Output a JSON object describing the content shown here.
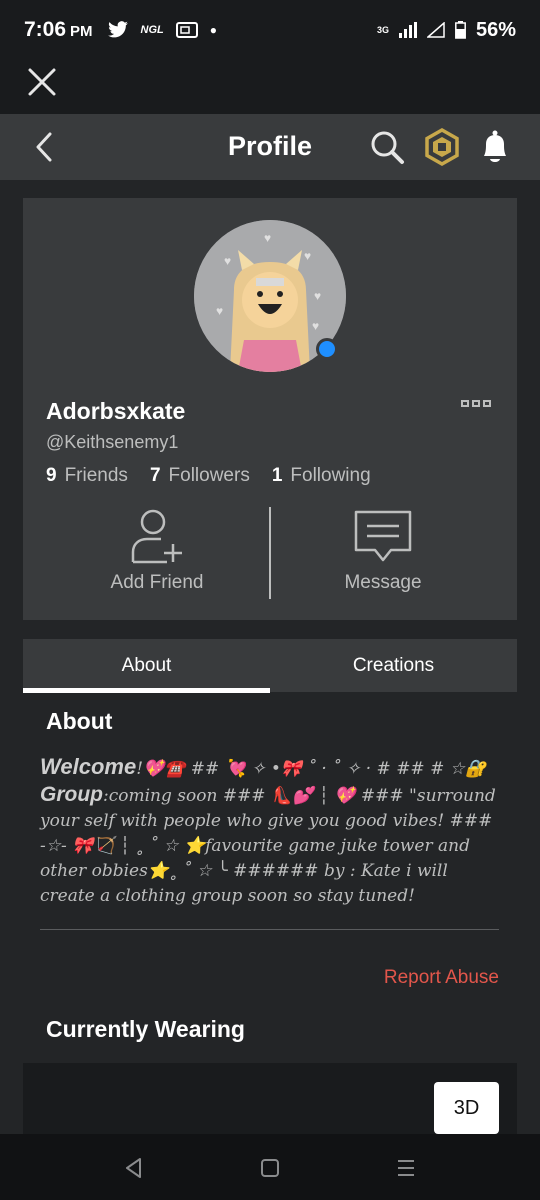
{
  "status": {
    "time": "7:06",
    "ampm": "PM",
    "carrier_label": "NGL",
    "battery": "56%",
    "network": "3G"
  },
  "header": {
    "title": "Profile"
  },
  "profile": {
    "display_name": "Adorbsxkate",
    "username": "@Keithsenemy1",
    "friends_count": "9",
    "friends_label": "Friends",
    "followers_count": "7",
    "followers_label": "Followers",
    "following_count": "1",
    "following_label": "Following"
  },
  "actions": {
    "add_friend": "Add Friend",
    "message": "Message"
  },
  "tabs": [
    {
      "label": "About"
    },
    {
      "label": "Creations"
    }
  ],
  "about": {
    "heading": "About",
    "welcome": "Welcome",
    "emoji_1": "!💖☎️ ## 💘 ✧ •🎀 ˚ · ˚ ✧ · #",
    "line_2": "## # ☆🔐 ",
    "group": "Group",
    "group_rest": ":coming soon ### 👠💕",
    "body": "┆ 💖 ### \"surround your self with people who give you good vibes! ### -☆- 🎀🏹 ┆ ˳ ˚ ☆ ⭐favourite game juke tower and other obbies⭐˳ ˚ ☆ ╰ ###### by : Kate i will create a clothing group soon so stay tuned!",
    "report": "Report Abuse"
  },
  "wearing": {
    "heading": "Currently Wearing",
    "btn_3d": "3D"
  },
  "colors": {
    "background": "#232527",
    "card": "#393b3d",
    "presence": "#1f8fff",
    "report": "#e2564b",
    "robux_gold": "#c8a84b"
  },
  "icons": {
    "close": "close-icon",
    "back": "back-chevron-icon",
    "search": "search-icon",
    "robux": "robux-icon",
    "notifications": "bell-icon",
    "add_friend": "add-friend-icon",
    "message": "message-icon"
  }
}
